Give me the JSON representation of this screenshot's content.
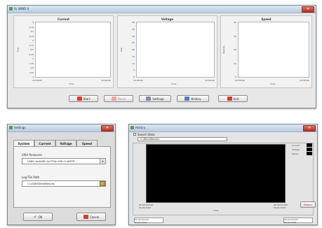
{
  "main_window": {
    "title": "SL WIND II",
    "plots": [
      {
        "title": "Current",
        "yticks": [
          "4",
          "3.75",
          "3.5",
          "3.25",
          "3",
          "2.75",
          "2.5",
          "2.25",
          "2",
          "1.75",
          "1.5",
          "1.25",
          "1"
        ],
        "ylabel": "Amp",
        "xlabel": "Time",
        "xstart": "10:58:08",
        "xend": "10:58:08"
      },
      {
        "title": "Voltage",
        "yticks": [
          "40",
          "35",
          "30",
          "25",
          "20",
          "15",
          "10",
          "5",
          "0"
        ],
        "ylabel": "Volt",
        "xlabel": "Time",
        "xstart": "10:58:08",
        "xend": "10:58:08"
      },
      {
        "title": "Speed",
        "yticks": [
          "40",
          "30",
          "20",
          "10",
          "0"
        ],
        "ylabel": "Velocity",
        "xlabel": "Time",
        "xstart": "10:58:08",
        "xend": "10:58:08"
      }
    ],
    "buttons": [
      "Start",
      "Pause",
      "Settings",
      "History",
      "Exit"
    ]
  },
  "settings_window": {
    "title": "Settings",
    "tabs": [
      "System",
      "Current",
      "Voltage",
      "Speed"
    ],
    "visa_label": "VISA Resource",
    "visa_value": "USB0::0x0ADE::0x7F5A::90E::0::INSTR",
    "logfile_label": "Log File Path",
    "logfile_value": "C:\\LSWD\\Wind\\Results",
    "ok": "OK",
    "cancel": "Cancel"
  },
  "history_window": {
    "title": "History",
    "section": "Search Data",
    "path": "C:\\Wind\\Results",
    "xlabel": "Time",
    "x_left": [
      "00:00:00.000",
      "01/01/1904"
    ],
    "x_right": [
      "00:00:00.000",
      "01/01/1904"
    ],
    "legend": [
      "Current",
      "Voltage",
      "Speed"
    ],
    "return": "Return",
    "footer_left": [
      "00:00:00.000",
      "01/01/1904"
    ],
    "footer_right": [
      "00:00:00.000",
      "01/01/1904"
    ]
  },
  "colors": {
    "title_bar": "#c6d7ec",
    "plot_bg": "#ffffff",
    "history_plot": "#000000",
    "danger": "#d23c2a"
  }
}
